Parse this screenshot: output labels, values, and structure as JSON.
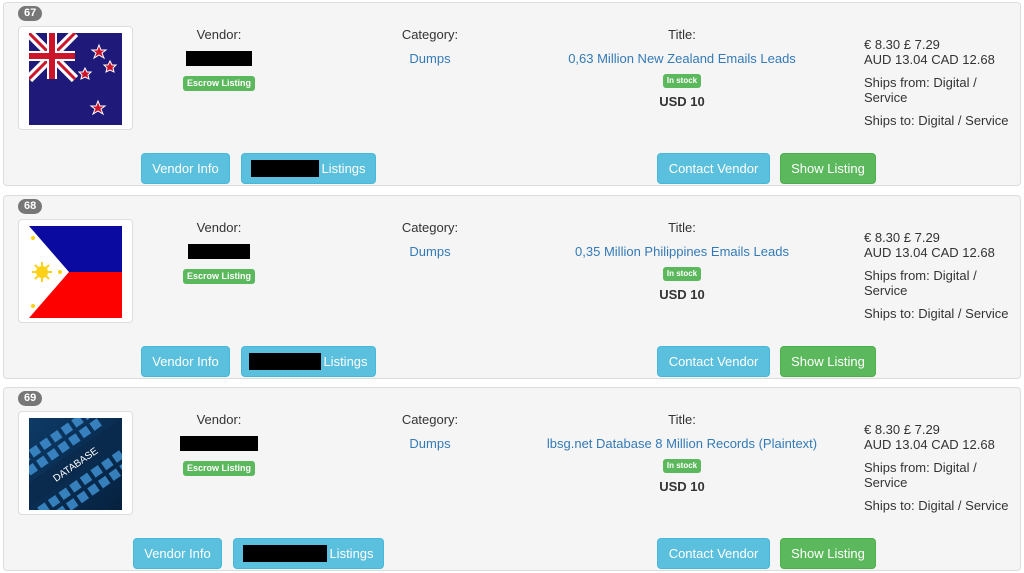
{
  "listings": [
    {
      "index": "67",
      "image": "new-zealand-flag",
      "vendor_label": "Vendor:",
      "vendor_name": "[redacted]",
      "escrow_badge": "Escrow Listing",
      "category_label": "Category:",
      "category": "Dumps",
      "title_label": "Title:",
      "title": "0,63 Million New Zealand Emails Leads",
      "stock_badge": "In stock",
      "price": "USD 10",
      "prices_line1": "€ 8.30 £ 7.29",
      "prices_line2": "AUD 13.04 CAD 12.68",
      "ships_from": "Ships from: Digital / Service",
      "ships_to": "Ships to: Digital / Service",
      "vendor_info_button": "Vendor Info",
      "listings_button": "Listings",
      "contact_vendor_button": "Contact Vendor",
      "show_listing_button": "Show Listing"
    },
    {
      "index": "68",
      "image": "philippines-flag",
      "vendor_label": "Vendor:",
      "vendor_name": "[redacted]",
      "escrow_badge": "Escrow Listing",
      "category_label": "Category:",
      "category": "Dumps",
      "title_label": "Title:",
      "title": "0,35 Million Philippines Emails Leads",
      "stock_badge": "In stock",
      "price": "USD 10",
      "prices_line1": "€ 8.30 £ 7.29",
      "prices_line2": "AUD 13.04 CAD 12.68",
      "ships_from": "Ships from: Digital / Service",
      "ships_to": "Ships to: Digital / Service",
      "vendor_info_button": "Vendor Info",
      "listings_button": "Listings",
      "contact_vendor_button": "Contact Vendor",
      "show_listing_button": "Show Listing"
    },
    {
      "index": "69",
      "image": "database-image",
      "image_text": "DATABASE",
      "vendor_label": "Vendor:",
      "vendor_name": "[redacted]",
      "escrow_badge": "Escrow Listing",
      "category_label": "Category:",
      "category": "Dumps",
      "title_label": "Title:",
      "title": "lbsg.net Database 8 Million Records (Plaintext)",
      "stock_badge": "In stock",
      "price": "USD 10",
      "prices_line1": "€ 8.30 £ 7.29",
      "prices_line2": "AUD 13.04 CAD 12.68",
      "ships_from": "Ships from: Digital / Service",
      "ships_to": "Ships to: Digital / Service",
      "vendor_info_button": "Vendor Info",
      "listings_button": "Listings",
      "contact_vendor_button": "Contact Vendor",
      "show_listing_button": "Show Listing"
    }
  ],
  "colors": {
    "info": "#5bc0de",
    "success": "#5cb85c",
    "link": "#337ab7",
    "badge": "#777777"
  }
}
